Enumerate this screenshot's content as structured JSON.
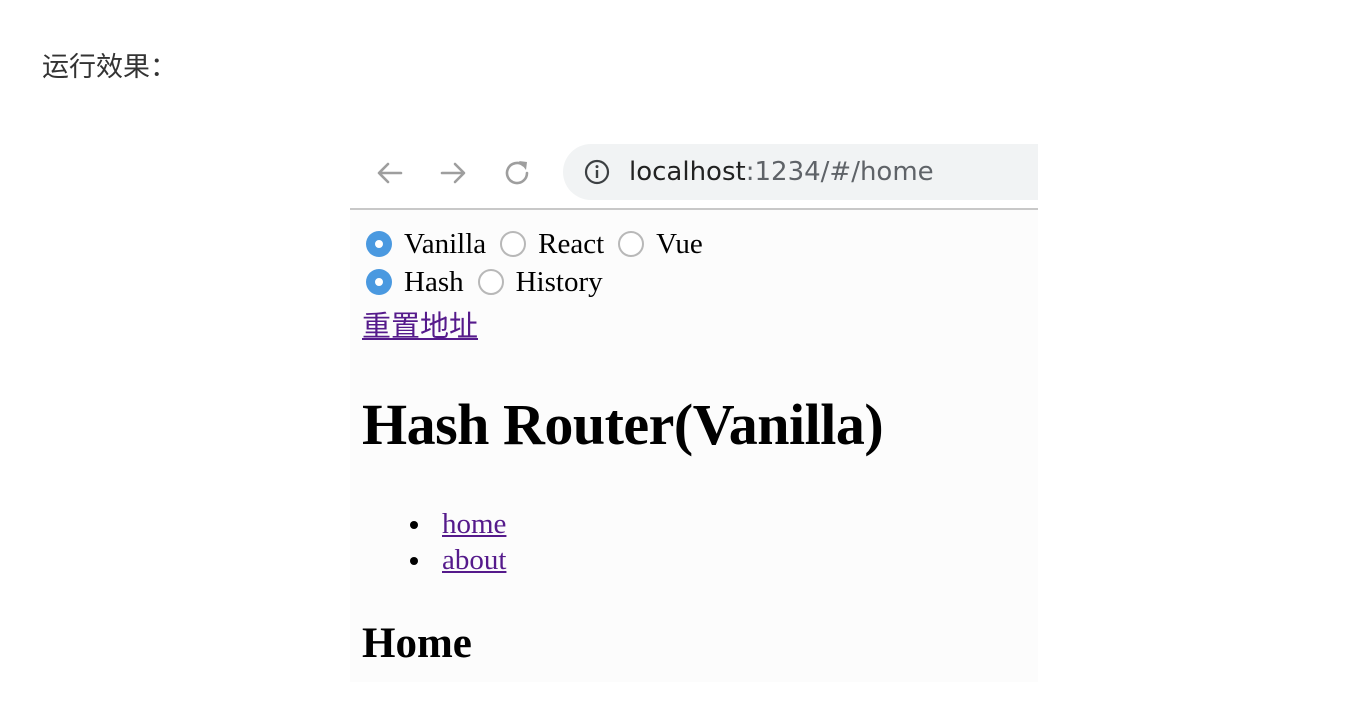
{
  "intro_text": "运行效果：",
  "browser": {
    "nav_icons": [
      "back-arrow-icon",
      "forward-arrow-icon",
      "reload-icon"
    ],
    "address_icon": "info-icon",
    "url_host": "localhost",
    "url_rest": ":1234/#/home"
  },
  "page": {
    "framework_options": [
      {
        "label": "Vanilla",
        "checked": true
      },
      {
        "label": "React",
        "checked": false
      },
      {
        "label": "Vue",
        "checked": false
      }
    ],
    "mode_options": [
      {
        "label": "Hash",
        "checked": true
      },
      {
        "label": "History",
        "checked": false
      }
    ],
    "reset_link": "重置地址",
    "title": "Hash Router(Vanilla)",
    "nav_links": [
      "home",
      "about"
    ],
    "route_heading": "Home"
  },
  "colors": {
    "radio_checked": "#4a99e0",
    "visited_link": "#551a8b",
    "address_bar_bg": "#f1f3f4"
  }
}
